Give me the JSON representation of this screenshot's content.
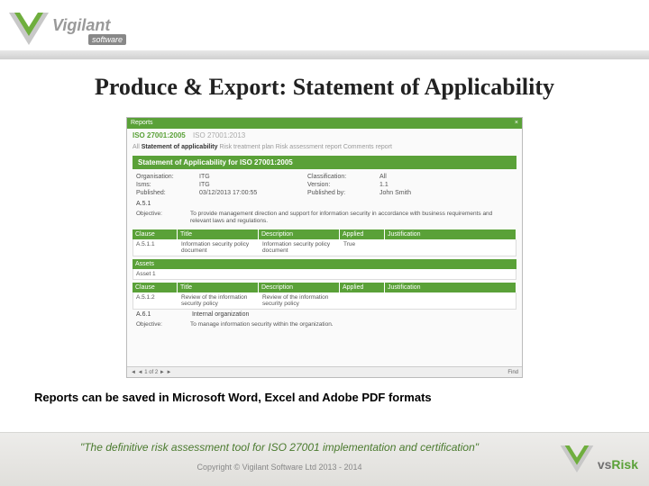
{
  "logo_top": {
    "brand": "Vigilant",
    "sub": "software"
  },
  "slide_title": "Produce & Export: Statement of Applicability",
  "screenshot": {
    "topbar": {
      "label": "Reports",
      "close": "×"
    },
    "iso_tabs": {
      "active": "ISO 27001:2005",
      "inactive": "ISO 27001:2013"
    },
    "subtabs": {
      "all": "All",
      "active": "Statement of applicability",
      "others": [
        "Risk treatment plan",
        "Risk assessment report",
        "Comments report"
      ]
    },
    "soa_title": "Statement of Applicability for ISO 27001:2005",
    "meta": {
      "org_lbl": "Organisation:",
      "org_val": "ITG",
      "class_lbl": "Classification:",
      "class_val": "All",
      "isms_lbl": "Isms:",
      "isms_val": "ITG",
      "ver_lbl": "Version:",
      "ver_val": "1.1",
      "pub_lbl": "Published:",
      "pub_val": "03/12/2013 17:00:55",
      "pubby_lbl": "Published by:",
      "pubby_val": "John Smith"
    },
    "section1": {
      "num": "A.5.1",
      "obj_lbl": "Objective:",
      "obj_val": "To provide management direction and support for information security in accordance with business requirements and relevant laws and regulations."
    },
    "table_head": {
      "clause": "Clause",
      "title": "Title",
      "desc": "Description",
      "applied": "Applied",
      "just": "Justification"
    },
    "row1": {
      "clause": "A.5.1.1",
      "title": "Information security policy document",
      "desc": "Information security policy document",
      "applied": "True",
      "just": ""
    },
    "assets_head": "Assets",
    "assets_row": "Asset 1",
    "row2": {
      "clause": "A.5.1.2",
      "title": "Review of the information security policy",
      "desc": "Review of the information security policy",
      "applied": "",
      "just": ""
    },
    "section2": {
      "num": "A.6.1",
      "title": "Internal organization",
      "obj_lbl": "Objective:",
      "obj_val": "To manage information security within the organization."
    },
    "toolbar": {
      "nav": "◄ ◄  1  of 2  ► ►",
      "find": "Find"
    }
  },
  "caption": "Reports can be saved in Microsoft Word, Excel and Adobe PDF formats",
  "footer": {
    "tagline": "\"The definitive risk assessment tool for ISO 27001 implementation and certification\"",
    "copyright": "Copyright © Vigilant Software Ltd  2013 - 2014"
  },
  "logo_bottom": {
    "vs": "vs",
    "risk": "Risk"
  }
}
